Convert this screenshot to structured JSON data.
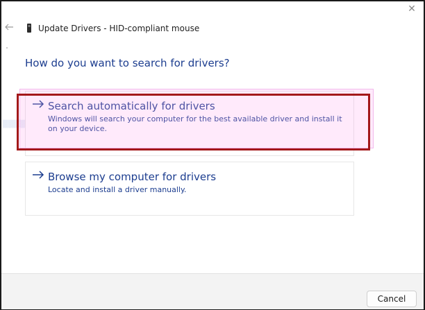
{
  "window": {
    "title": "Update Drivers - HID-compliant mouse",
    "close_icon": "close-icon",
    "back_icon": "back-arrow-icon",
    "device_icon": "mouse-icon"
  },
  "main": {
    "heading": "How do you want to search for drivers?",
    "options": [
      {
        "title": "Search automatically for drivers",
        "description": "Windows will search your computer for the best available driver and install it on your device.",
        "icon": "arrow-right-icon"
      },
      {
        "title": "Browse my computer for drivers",
        "description": "Locate and install a driver manually.",
        "icon": "arrow-right-icon"
      }
    ]
  },
  "footer": {
    "cancel_label": "Cancel"
  },
  "colors": {
    "accent": "#1c3d8f",
    "highlight_box": "#a3181a",
    "footer_bg": "#f3f3f3"
  }
}
